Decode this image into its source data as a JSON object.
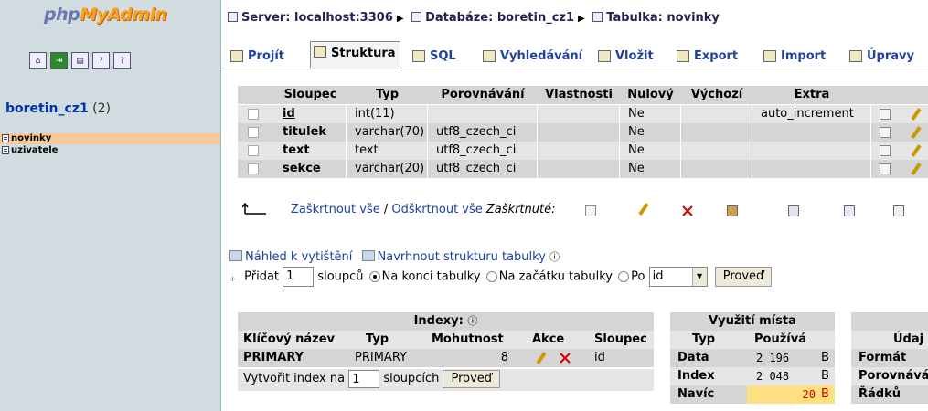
{
  "logo": {
    "part1": "php",
    "part2": "MyAdmin"
  },
  "sidebar": {
    "db_name": "boretin_cz1",
    "db_count": "(2)",
    "tables": [
      "novinky",
      "uzivatele"
    ]
  },
  "breadcrumb": {
    "server": "Server: localhost:3306",
    "database": "Databáze: boretin_cz1",
    "table": "Tabulka: novinky"
  },
  "tabs": [
    "Projít",
    "Struktura",
    "SQL",
    "Vyhledávání",
    "Vložit",
    "Export",
    "Import",
    "Úpravy"
  ],
  "structure": {
    "headers": [
      "Sloupec",
      "Typ",
      "Porovnávání",
      "Vlastnosti",
      "Nulový",
      "Výchozí",
      "Extra"
    ],
    "rows": [
      {
        "name": "id",
        "type": "int(11)",
        "collation": "",
        "attr": "",
        "null": "Ne",
        "default": "",
        "extra": "auto_increment"
      },
      {
        "name": "titulek",
        "type": "varchar(70)",
        "collation": "utf8_czech_ci",
        "attr": "",
        "null": "Ne",
        "default": "",
        "extra": ""
      },
      {
        "name": "text",
        "type": "text",
        "collation": "utf8_czech_ci",
        "attr": "",
        "null": "Ne",
        "default": "",
        "extra": ""
      },
      {
        "name": "sekce",
        "type": "varchar(20)",
        "collation": "utf8_czech_ci",
        "attr": "",
        "null": "Ne",
        "default": "",
        "extra": ""
      }
    ],
    "check_all": "Zaškrtnout vše",
    "sep": " / ",
    "uncheck_all": "Odškrtnout vše",
    "checked_label": "Zaškrtnuté:"
  },
  "links": {
    "print": "Náhled k vytištění",
    "propose": "Navrhnout strukturu tabulky"
  },
  "add": {
    "label": "Přidat",
    "count": "1",
    "columns": "sloupců",
    "opt_end": "Na konci tabulky",
    "opt_start": "Na začátku tabulky",
    "opt_after": "Po",
    "after_value": "id",
    "go": "Proveď"
  },
  "indexes": {
    "title": "Indexy:",
    "headers": [
      "Klíčový název",
      "Typ",
      "Mohutnost",
      "Akce",
      "Sloupec"
    ],
    "row": {
      "name": "PRIMARY",
      "type": "PRIMARY",
      "card": "8",
      "col": "id"
    },
    "create_label": "Vytvořit index na",
    "create_count": "1",
    "create_cols": "sloupcích",
    "go": "Proveď"
  },
  "space": {
    "title": "Využití místa",
    "headers": [
      "Typ",
      "Používá"
    ],
    "rows": [
      {
        "t": "Data",
        "v": "2 196",
        "u": "B"
      },
      {
        "t": "Index",
        "v": "2 048",
        "u": "B"
      },
      {
        "t": "Navíc",
        "v": "20",
        "u": "B"
      }
    ]
  },
  "info": {
    "title": "Údaj",
    "rows": [
      "Formát",
      "Porovnává",
      "Řádků"
    ]
  }
}
